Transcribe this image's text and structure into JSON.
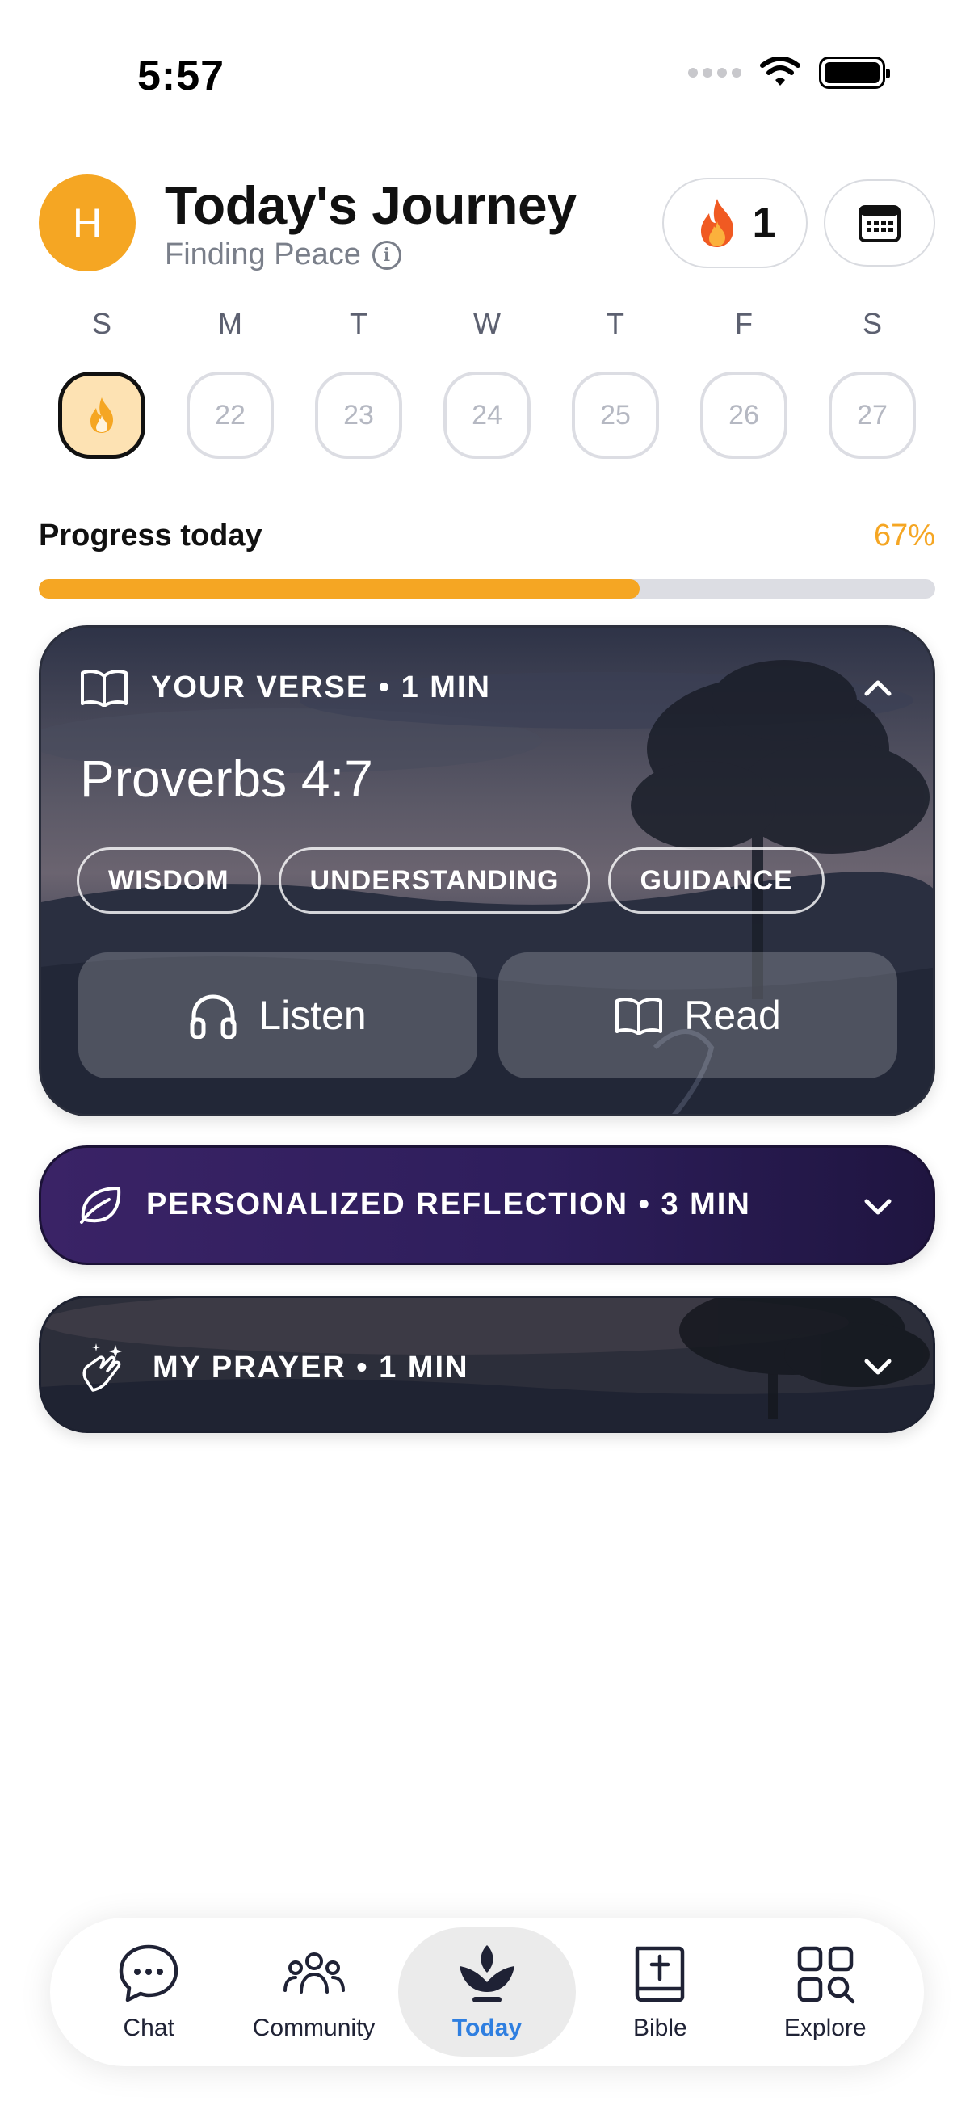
{
  "status_bar": {
    "time": "5:57"
  },
  "header": {
    "avatar_initial": "H",
    "title": "Today's Journey",
    "subtitle": "Finding Peace",
    "streak_count": "1"
  },
  "week": {
    "labels": [
      "S",
      "M",
      "T",
      "W",
      "T",
      "F",
      "S"
    ],
    "days": [
      "",
      "22",
      "23",
      "24",
      "25",
      "26",
      "27"
    ]
  },
  "progress": {
    "label": "Progress today",
    "percent_text": "67%",
    "value": 0.67,
    "color": "#f5a623"
  },
  "verse_card": {
    "header": "YOUR VERSE • 1 MIN",
    "reference": "Proverbs 4:7",
    "tags": [
      "WISDOM",
      "UNDERSTANDING",
      "GUIDANCE"
    ],
    "listen_label": "Listen",
    "read_label": "Read"
  },
  "reflection_card": {
    "header": "PERSONALIZED REFLECTION • 3 MIN"
  },
  "prayer_card": {
    "header": "MY PRAYER • 1 MIN"
  },
  "tab_bar": {
    "items": [
      {
        "label": "Chat",
        "icon": "chat-bubble-icon"
      },
      {
        "label": "Community",
        "icon": "people-icon"
      },
      {
        "label": "Today",
        "icon": "sprout-icon"
      },
      {
        "label": "Bible",
        "icon": "bible-icon"
      },
      {
        "label": "Explore",
        "icon": "explore-grid-icon"
      }
    ],
    "active": "Today",
    "active_color": "#2f7fe0"
  }
}
